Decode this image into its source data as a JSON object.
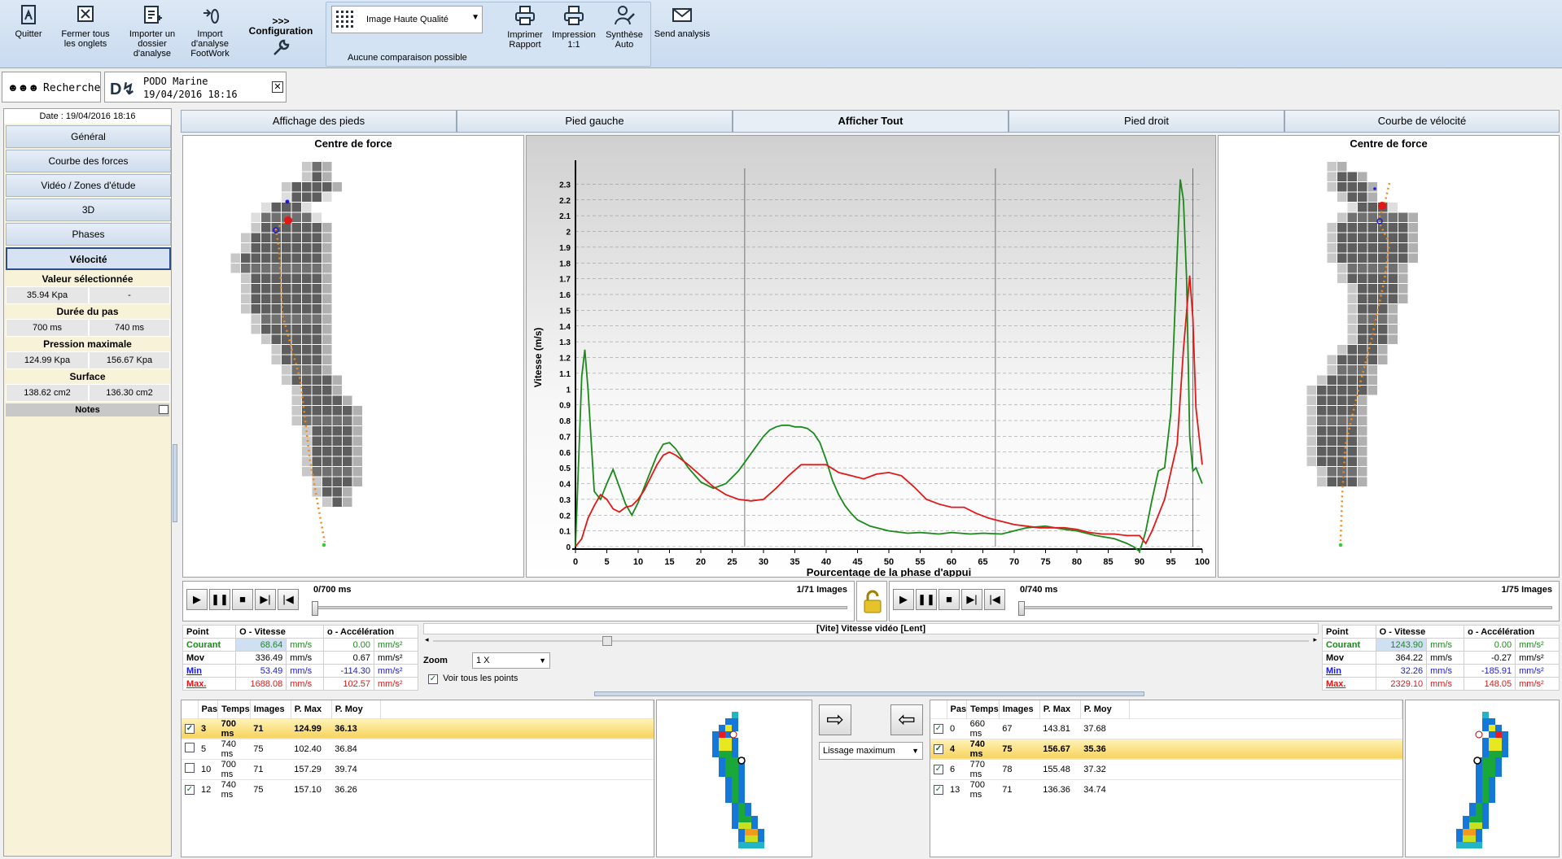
{
  "toolbar": {
    "quit": "Quitter",
    "close_tabs": "Fermer tous les onglets",
    "import_folder": "Importer un dossier d'analyse",
    "import_footwork": "Import d'analyse FootWork",
    "config_arrows": ">>>",
    "config": "Configuration",
    "quality": "Image Haute Qualité",
    "no_compare": "Aucune comparaison possible",
    "print_report": "Imprimer Rapport",
    "print_11": "Impression 1:1",
    "synthesis": "Synthèse Auto",
    "send": "Send analysis"
  },
  "tabs": {
    "search": "Recherche",
    "patient_name": "PODO Marine",
    "patient_date": "19/04/2016 18:16"
  },
  "left": {
    "date": "Date : 19/04/2016 18:16",
    "buttons": [
      "Général",
      "Courbe des forces",
      "Vidéo / Zones d'étude",
      "3D",
      "Phases",
      "Vélocité"
    ],
    "sel_value_h": "Valeur sélectionnée",
    "sel_value": [
      "35.94 Kpa",
      "-"
    ],
    "duration_h": "Durée du pas",
    "duration": [
      "700 ms",
      "740 ms"
    ],
    "pmax_h": "Pression maximale",
    "pmax": [
      "124.99 Kpa",
      "156.67 Kpa"
    ],
    "surface_h": "Surface",
    "surface": [
      "138.62 cm2",
      "136.30 cm2"
    ],
    "notes": "Notes"
  },
  "view_tabs": [
    "Affichage des pieds",
    "Pied gauche",
    "Afficher Tout",
    "Pied droit",
    "Courbe de vélocité"
  ],
  "cof_title": "Centre de force",
  "chart_data": {
    "type": "line",
    "xlabel": "Pourcentage de la phase d'appui",
    "ylabel": "Vitesse (m/s)",
    "xlim": [
      0,
      100
    ],
    "ylim": [
      0,
      2.4
    ],
    "xticks": [
      0,
      5,
      10,
      15,
      20,
      25,
      30,
      35,
      40,
      45,
      50,
      55,
      60,
      65,
      70,
      75,
      80,
      85,
      90,
      95,
      100
    ],
    "yticks": [
      0,
      0.1,
      0.2,
      0.3,
      0.4,
      0.5,
      0.6,
      0.7,
      0.8,
      0.9,
      1,
      1.1,
      1.2,
      1.3,
      1.4,
      1.5,
      1.6,
      1.7,
      1.8,
      1.9,
      2,
      2.1,
      2.2,
      2.3
    ],
    "series": [
      {
        "color": "#1a8a1a",
        "x": [
          0,
          1,
          1.5,
          2,
          3,
          4,
          5,
          6,
          7,
          8,
          9,
          10,
          11,
          12,
          13,
          14,
          15,
          16,
          17,
          18,
          20,
          22,
          24,
          26,
          28,
          30,
          31,
          32,
          33,
          34,
          35,
          36,
          37,
          38,
          39,
          40,
          41,
          42,
          43,
          44,
          45,
          47,
          50,
          53,
          55,
          58,
          60,
          63,
          65,
          68,
          70,
          72,
          75,
          78,
          80,
          83,
          86,
          88,
          89,
          90,
          90.5,
          91,
          92,
          93,
          94,
          95,
          96,
          96.5,
          97,
          97.5,
          98,
          98.5,
          99,
          100
        ],
        "y": [
          0,
          1.08,
          1.25,
          1.0,
          0.35,
          0.3,
          0.4,
          0.49,
          0.38,
          0.27,
          0.2,
          0.28,
          0.38,
          0.48,
          0.58,
          0.65,
          0.66,
          0.62,
          0.56,
          0.5,
          0.41,
          0.37,
          0.4,
          0.48,
          0.59,
          0.7,
          0.74,
          0.76,
          0.77,
          0.77,
          0.76,
          0.76,
          0.75,
          0.72,
          0.66,
          0.55,
          0.42,
          0.33,
          0.26,
          0.21,
          0.17,
          0.13,
          0.1,
          0.085,
          0.09,
          0.08,
          0.09,
          0.08,
          0.085,
          0.08,
          0.1,
          0.12,
          0.13,
          0.11,
          0.1,
          0.07,
          0.05,
          0.02,
          0.0,
          -0.03,
          0.03,
          0.1,
          0.3,
          0.48,
          0.5,
          0.85,
          1.85,
          2.33,
          2.2,
          1.7,
          0.7,
          0.48,
          0.5,
          0.4
        ]
      },
      {
        "color": "#e01818",
        "x": [
          0,
          1,
          2,
          3,
          4,
          5,
          6,
          7,
          8,
          9,
          10,
          11,
          12,
          13,
          14,
          15,
          16,
          17,
          18,
          20,
          22,
          24,
          26,
          28,
          30,
          32,
          34,
          36,
          38,
          40,
          42,
          44,
          46,
          48,
          50,
          52,
          54,
          56,
          58,
          60,
          62,
          64,
          66,
          68,
          70,
          72,
          74,
          76,
          78,
          80,
          82,
          84,
          86,
          88,
          90,
          91,
          92,
          94,
          96,
          97,
          98,
          98.5,
          99,
          100
        ],
        "y": [
          0,
          0.05,
          0.18,
          0.26,
          0.33,
          0.3,
          0.24,
          0.22,
          0.25,
          0.26,
          0.3,
          0.36,
          0.44,
          0.52,
          0.58,
          0.6,
          0.58,
          0.55,
          0.52,
          0.45,
          0.38,
          0.33,
          0.3,
          0.29,
          0.3,
          0.37,
          0.45,
          0.52,
          0.52,
          0.52,
          0.47,
          0.45,
          0.43,
          0.46,
          0.47,
          0.45,
          0.38,
          0.3,
          0.27,
          0.25,
          0.25,
          0.21,
          0.18,
          0.16,
          0.14,
          0.13,
          0.12,
          0.12,
          0.12,
          0.11,
          0.09,
          0.08,
          0.08,
          0.07,
          0.07,
          0.02,
          0.1,
          0.3,
          0.65,
          1.25,
          1.72,
          1.45,
          0.88,
          0.52
        ]
      }
    ],
    "vlines": [
      27,
      67,
      98.5
    ]
  },
  "player_left": {
    "time": "0/700 ms",
    "images": "1/71 Images"
  },
  "player_right": {
    "time": "0/740 ms",
    "images": "1/75 Images"
  },
  "stats_headers": [
    "Point",
    "O - Vitesse",
    "o - Accélération"
  ],
  "stats_left": [
    {
      "label": "Courant",
      "v": "68.64",
      "vu": "mm/s",
      "a": "0.00",
      "au": "mm/s²",
      "color": "#1a8a1a"
    },
    {
      "label": "Mov",
      "v": "336.49",
      "vu": "mm/s",
      "a": "0.67",
      "au": "mm/s²",
      "color": "#000"
    },
    {
      "label": "Min",
      "v": "53.49",
      "vu": "mm/s",
      "a": "-114.30",
      "au": "mm/s²",
      "color": "#1a1ae0"
    },
    {
      "label": "Max.",
      "v": "1688.08",
      "vu": "mm/s",
      "a": "102.57",
      "au": "mm/s²",
      "color": "#e01818"
    }
  ],
  "stats_right": [
    {
      "label": "Courant",
      "v": "1243.90",
      "vu": "mm/s",
      "a": "0.00",
      "au": "mm/s²",
      "color": "#1a8a1a"
    },
    {
      "label": "Mov",
      "v": "364.22",
      "vu": "mm/s",
      "a": "-0.27",
      "au": "mm/s²",
      "color": "#000"
    },
    {
      "label": "Min",
      "v": "32.26",
      "vu": "mm/s",
      "a": "-185.91",
      "au": "mm/s²",
      "color": "#1a1ae0"
    },
    {
      "label": "Max.",
      "v": "2329.10",
      "vu": "mm/s",
      "a": "148.05",
      "au": "mm/s²",
      "color": "#e01818"
    }
  ],
  "video_speed": "[Vite]  Vitesse vidéo  [Lent]",
  "zoom_label": "Zoom",
  "zoom_value": "1 X",
  "show_points": "Voir tous les points",
  "smoothing": "Lissage maximum",
  "steps_headers": [
    "Pas",
    "Temps",
    "Images",
    "P. Max",
    "P. Moy"
  ],
  "steps_left": [
    {
      "checked": true,
      "sel": true,
      "pas": "3",
      "temps": "700 ms",
      "images": "71",
      "pmax": "124.99",
      "pmoy": "36.13"
    },
    {
      "checked": false,
      "sel": false,
      "pas": "5",
      "temps": "740 ms",
      "images": "75",
      "pmax": "102.40",
      "pmoy": "36.84"
    },
    {
      "checked": false,
      "sel": false,
      "pas": "10",
      "temps": "700 ms",
      "images": "71",
      "pmax": "157.29",
      "pmoy": "39.74"
    },
    {
      "checked": true,
      "sel": false,
      "pas": "12",
      "temps": "740 ms",
      "images": "75",
      "pmax": "157.10",
      "pmoy": "36.26"
    }
  ],
  "steps_right": [
    {
      "checked": true,
      "sel": false,
      "pas": "0",
      "temps": "660 ms",
      "images": "67",
      "pmax": "143.81",
      "pmoy": "37.68"
    },
    {
      "checked": true,
      "sel": true,
      "pas": "4",
      "temps": "740 ms",
      "images": "75",
      "pmax": "156.67",
      "pmoy": "35.36"
    },
    {
      "checked": true,
      "sel": false,
      "pas": "6",
      "temps": "770 ms",
      "images": "78",
      "pmax": "155.48",
      "pmoy": "37.32"
    },
    {
      "checked": true,
      "sel": false,
      "pas": "13",
      "temps": "700 ms",
      "images": "71",
      "pmax": "136.36",
      "pmoy": "34.74"
    }
  ]
}
